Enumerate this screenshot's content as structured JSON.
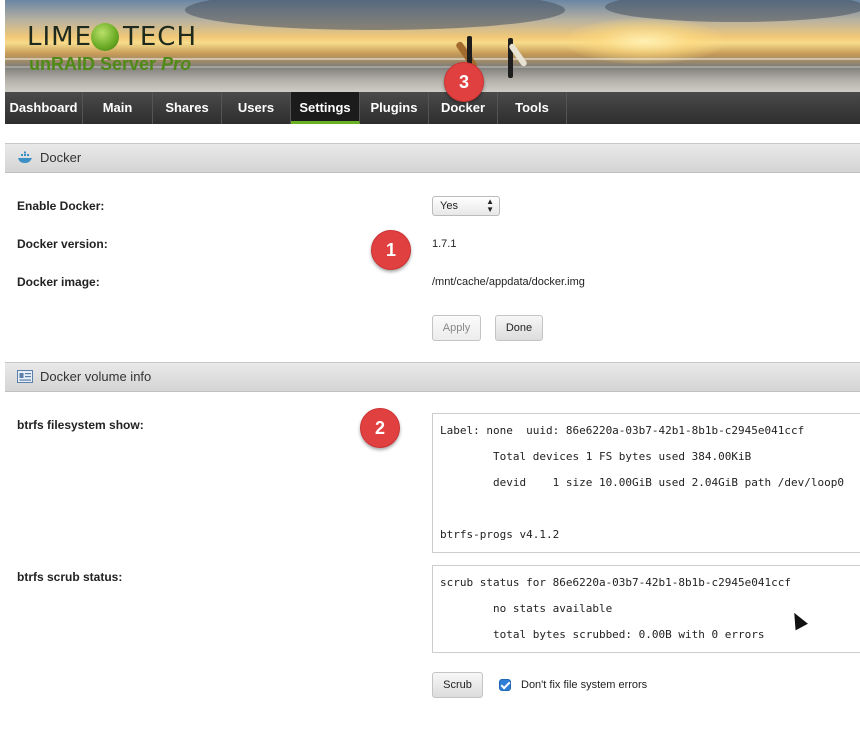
{
  "brand": {
    "logo_lime": "LIME",
    "logo_tech": "TECH",
    "product": "unRAID Server",
    "edition": "Pro"
  },
  "nav": {
    "items": [
      {
        "label": "Dashboard"
      },
      {
        "label": "Main"
      },
      {
        "label": "Shares"
      },
      {
        "label": "Users"
      },
      {
        "label": "Settings",
        "active": true
      },
      {
        "label": "Plugins"
      },
      {
        "label": "Docker"
      },
      {
        "label": "Tools"
      }
    ]
  },
  "badges": [
    "1",
    "2",
    "3"
  ],
  "docker_section": {
    "title": "Docker",
    "icon": "docker-whale-icon",
    "enable_label": "Enable Docker:",
    "enable_value": "Yes",
    "version_label": "Docker version:",
    "version_value": "1.7.1",
    "image_label": "Docker image:",
    "image_value": "/mnt/cache/appdata/docker.img",
    "apply_label": "Apply",
    "done_label": "Done"
  },
  "volume_section": {
    "title": "Docker volume info",
    "icon": "info-card-icon",
    "fs_show_label": "btrfs filesystem show:",
    "fs_show_lines": [
      "Label: none  uuid: 86e6220a-03b7-42b1-8b1b-c2945e041ccf",
      "        Total devices 1 FS bytes used 384.00KiB",
      "        devid    1 size 10.00GiB used 2.04GiB path /dev/loop0",
      "",
      "btrfs-progs v4.1.2"
    ],
    "scrub_label": "btrfs scrub status:",
    "scrub_lines": [
      "scrub status for 86e6220a-03b7-42b1-8b1b-c2945e041ccf",
      "        no stats available",
      "        total bytes scrubbed: 0.00B with 0 errors"
    ],
    "scrub_button": "Scrub",
    "nofix_label": "Don't fix file system errors",
    "nofix_checked": true
  },
  "colors": {
    "accent_green": "#6ab023",
    "badge_red": "#e04040",
    "checkbox_blue": "#2f7fd6"
  }
}
